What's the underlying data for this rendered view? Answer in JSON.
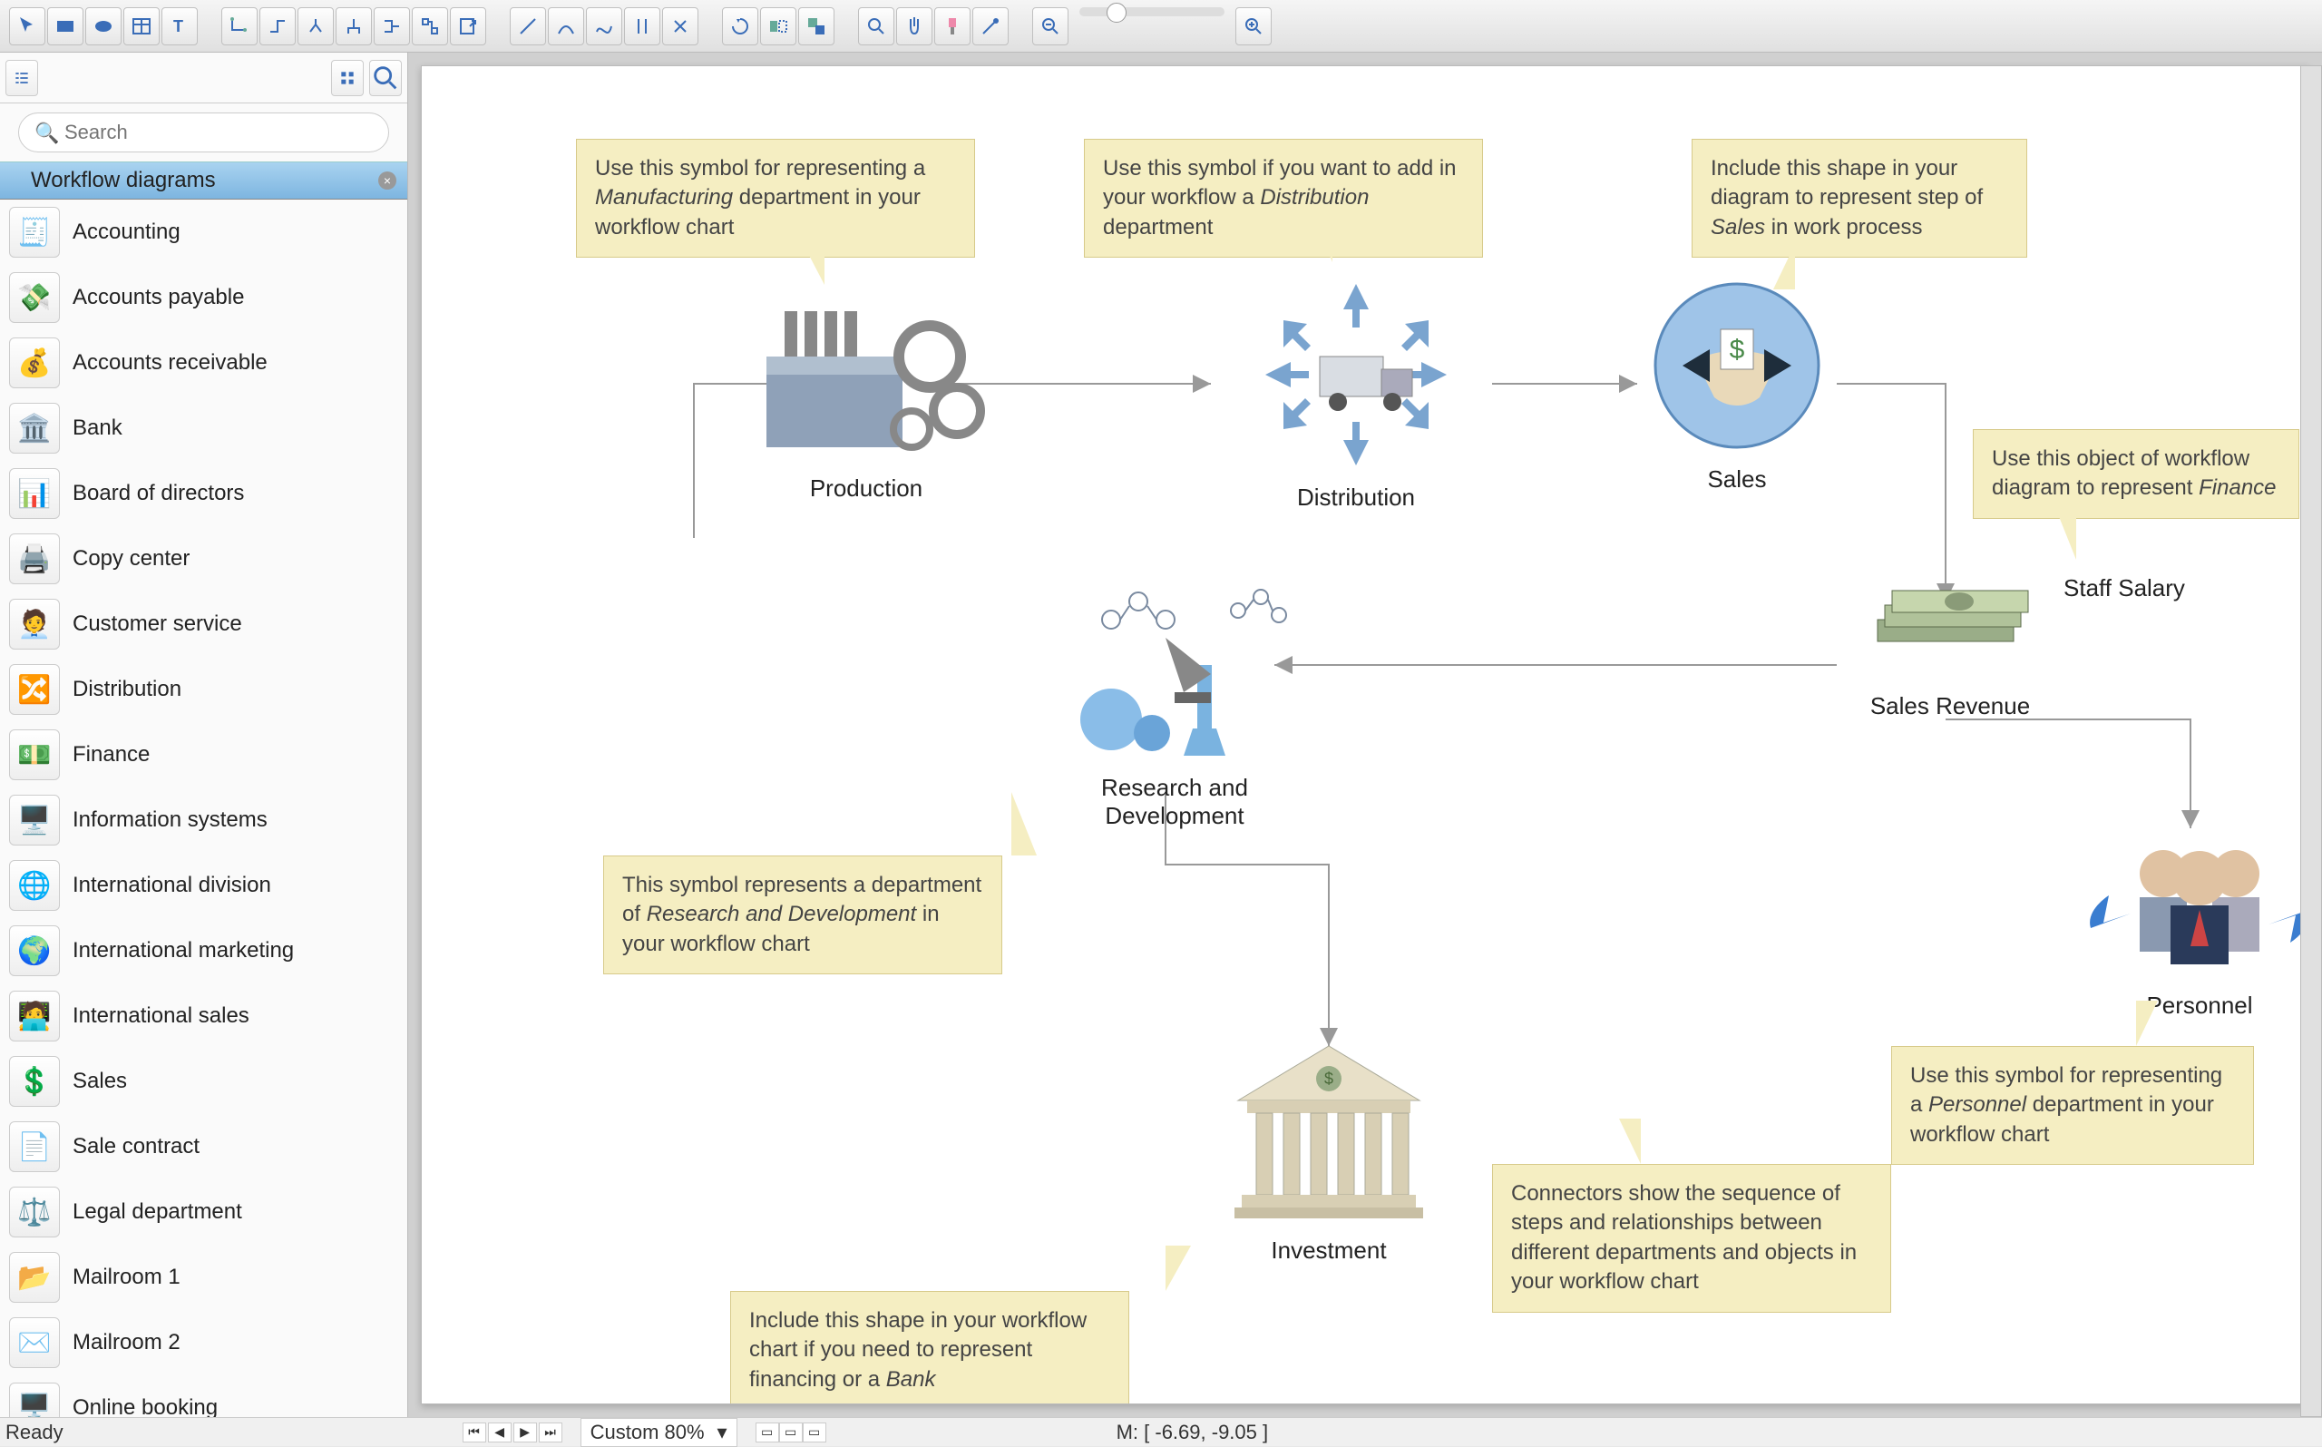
{
  "toolbar": {
    "groups": [
      [
        "pointer",
        "rect",
        "ellipse",
        "table",
        "text"
      ],
      [
        "connector-l",
        "connector-elbow",
        "connector-branch",
        "connector-tree",
        "connector-side",
        "connector-multi",
        "export"
      ],
      [
        "line-diag",
        "line-curve",
        "line-free",
        "line-vert",
        "line-snap"
      ],
      [
        "rotate",
        "flip-h",
        "group"
      ],
      [
        "zoom-in-tool",
        "pan-tool",
        "format-brush",
        "eyedropper"
      ],
      [
        "zoom-out",
        "zoom-slider",
        "zoom-in"
      ]
    ]
  },
  "sidebar": {
    "search_placeholder": "Search",
    "title": "Workflow diagrams",
    "items": [
      {
        "label": "Accounting",
        "icon": "🧾"
      },
      {
        "label": "Accounts payable",
        "icon": "💸"
      },
      {
        "label": "Accounts receivable",
        "icon": "💰"
      },
      {
        "label": "Bank",
        "icon": "🏛️"
      },
      {
        "label": "Board of directors",
        "icon": "📊"
      },
      {
        "label": "Copy center",
        "icon": "🖨️"
      },
      {
        "label": "Customer service",
        "icon": "🧑‍💼"
      },
      {
        "label": "Distribution",
        "icon": "🔀"
      },
      {
        "label": "Finance",
        "icon": "💵"
      },
      {
        "label": "Information systems",
        "icon": "🖥️"
      },
      {
        "label": "International division",
        "icon": "🌐"
      },
      {
        "label": "International marketing",
        "icon": "🌍"
      },
      {
        "label": "International sales",
        "icon": "🧑‍💻"
      },
      {
        "label": "Sales",
        "icon": "💲"
      },
      {
        "label": "Sale contract",
        "icon": "📄"
      },
      {
        "label": "Legal department",
        "icon": "⚖️"
      },
      {
        "label": "Mailroom 1",
        "icon": "📂"
      },
      {
        "label": "Mailroom 2",
        "icon": "✉️"
      },
      {
        "label": "Online booking",
        "icon": "🖥️"
      }
    ]
  },
  "nodes": {
    "production": "Production",
    "distribution": "Distribution",
    "sales": "Sales",
    "staff_salary": "Staff Salary",
    "sales_revenue": "Sales Revenue",
    "rnd": "Research and Development",
    "personnel": "Personnel",
    "investment": "Investment"
  },
  "callouts": {
    "production": "Use this symbol for representing a <em>Manufacturing</em> department in your workflow chart",
    "distribution": "Use this symbol if you want to add in your workflow a <em>Distribution</em> department",
    "sales": "Include this shape in your diagram to represent step of <em>Sales</em> in work process",
    "finance": "Use this object of workflow diagram to represent <em>Finance</em>",
    "rnd": "This symbol represents a department of <em>Research and Development</em> in your workflow chart",
    "personnel": "Use this symbol for representing a <em>Personnel</em> department in your workflow chart",
    "investment": "Include this shape in your workflow chart if you need to represent financing or a <em>Bank</em>",
    "connectors": "Connectors show the sequence of steps and relationships between different departments and objects in your workflow chart"
  },
  "status": {
    "ready": "Ready",
    "zoom": "Custom 80%",
    "mouse": "M: [ -6.69, -9.05 ]"
  }
}
